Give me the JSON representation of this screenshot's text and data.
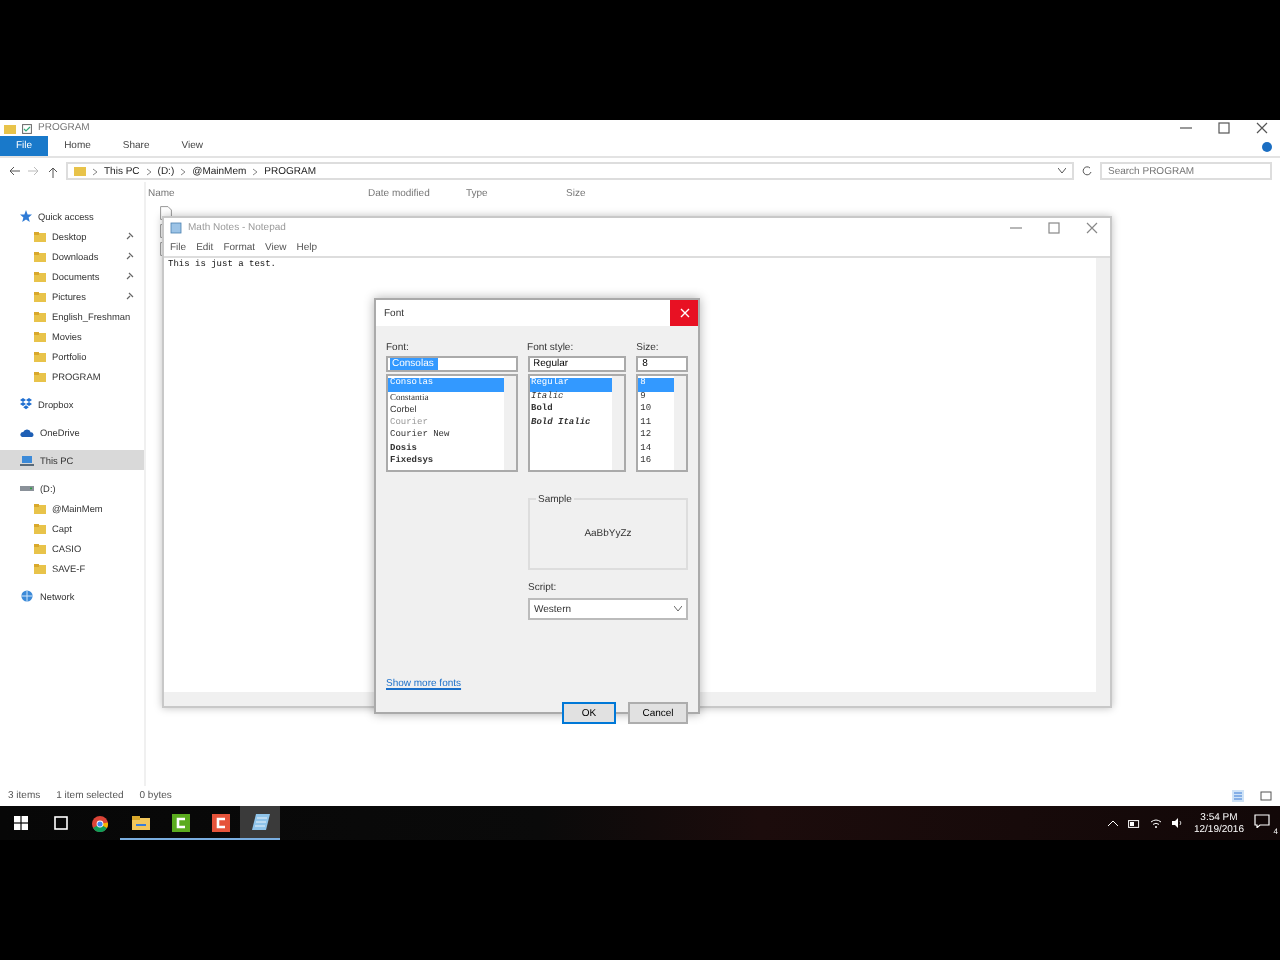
{
  "explorer": {
    "title": "PROGRAM",
    "ribbon_tabs": [
      {
        "label": "File",
        "selected": true
      },
      {
        "label": "Home",
        "selected": false
      },
      {
        "label": "Share",
        "selected": false
      },
      {
        "label": "View",
        "selected": false
      }
    ],
    "breadcrumb": [
      "This PC",
      "(D:)",
      "@MainMem",
      "PROGRAM"
    ],
    "search": {
      "placeholder": "Search PROGRAM"
    },
    "columns": [
      "Name",
      "Date modified",
      "Type",
      "Size"
    ],
    "sidebar": [
      {
        "label": "Quick access",
        "kind": "star",
        "selected": false,
        "children": [
          {
            "label": "Desktop",
            "kind": "folder",
            "pinned": true,
            "selected": false
          },
          {
            "label": "Downloads",
            "kind": "folder",
            "pinned": true,
            "selected": false
          },
          {
            "label": "Documents",
            "kind": "folder",
            "pinned": true,
            "selected": false
          },
          {
            "label": "Pictures",
            "kind": "folder",
            "pinned": true,
            "selected": false
          },
          {
            "label": "English_Freshman",
            "kind": "folder",
            "pinned": false,
            "selected": false
          },
          {
            "label": "Movies",
            "kind": "folder",
            "pinned": false,
            "selected": false
          },
          {
            "label": "Portfolio",
            "kind": "folder",
            "pinned": false,
            "selected": false
          },
          {
            "label": "PROGRAM",
            "kind": "folder",
            "pinned": false,
            "selected": false
          }
        ]
      },
      {
        "label": "Dropbox",
        "kind": "dropbox",
        "selected": false
      },
      {
        "label": "OneDrive",
        "kind": "cloud",
        "selected": false
      },
      {
        "label": "This PC",
        "kind": "pc",
        "selected": true
      },
      {
        "label": "(D:)",
        "kind": "drive",
        "selected": false,
        "children": [
          {
            "label": "@MainMem",
            "kind": "folder",
            "pinned": false,
            "selected": false
          },
          {
            "label": "Capt",
            "kind": "folder",
            "pinned": false,
            "selected": false
          },
          {
            "label": "CASIO",
            "kind": "folder",
            "pinned": false,
            "selected": false
          },
          {
            "label": "SAVE-F",
            "kind": "folder",
            "pinned": false,
            "selected": false
          }
        ]
      },
      {
        "label": "Network",
        "kind": "network",
        "selected": false
      }
    ],
    "status": [
      "3 items",
      "1 item selected",
      "0 bytes"
    ]
  },
  "notepad": {
    "title": "Math Notes - Notepad",
    "menu": [
      "File",
      "Edit",
      "Format",
      "View",
      "Help"
    ],
    "content": "This is just a test."
  },
  "font_dialog": {
    "title": "Font",
    "font_label": "Font:",
    "font_value": "Consolas",
    "fonts": [
      {
        "label": "Consolas",
        "kind": "mono",
        "selected": true
      },
      {
        "label": "Constantia",
        "kind": "serif",
        "selected": false
      },
      {
        "label": "Corbel",
        "kind": "sans",
        "selected": false
      },
      {
        "label": "Courier",
        "kind": "faint",
        "selected": false
      },
      {
        "label": "Courier New",
        "kind": "mono",
        "selected": false
      },
      {
        "label": "Dosis",
        "kind": "bold",
        "selected": false
      },
      {
        "label": "Fixedsys",
        "kind": "bold",
        "selected": false
      }
    ],
    "style_label": "Font style:",
    "style_value": "Regular",
    "styles": [
      {
        "label": "Regular",
        "kind": "regular",
        "selected": true
      },
      {
        "label": "Italic",
        "kind": "italic",
        "selected": false
      },
      {
        "label": "Bold",
        "kind": "bold",
        "selected": false
      },
      {
        "label": "Bold Italic",
        "kind": "bolditalic",
        "selected": false
      }
    ],
    "size_label": "Size:",
    "size_value": "8",
    "sizes": [
      {
        "label": "8",
        "selected": true
      },
      {
        "label": "9",
        "selected": false
      },
      {
        "label": "10",
        "selected": false
      },
      {
        "label": "11",
        "selected": false
      },
      {
        "label": "12",
        "selected": false
      },
      {
        "label": "14",
        "selected": false
      },
      {
        "label": "16",
        "selected": false
      }
    ],
    "sample_label": "Sample",
    "sample_text": "AaBbYyZz",
    "script_label": "Script:",
    "script_value": "Western",
    "link": "Show more fonts",
    "buttons": [
      "OK",
      "Cancel"
    ]
  },
  "taskbar": {
    "apps": [
      {
        "kind": "chrome",
        "open": false,
        "selected": false
      },
      {
        "kind": "explorer",
        "open": true,
        "selected": false
      },
      {
        "kind": "green",
        "open": true,
        "selected": false
      },
      {
        "kind": "red",
        "open": true,
        "selected": false
      },
      {
        "kind": "notepad",
        "open": true,
        "selected": true
      }
    ],
    "time": "3:54 PM",
    "date": "12/19/2016",
    "notifications": "4"
  }
}
